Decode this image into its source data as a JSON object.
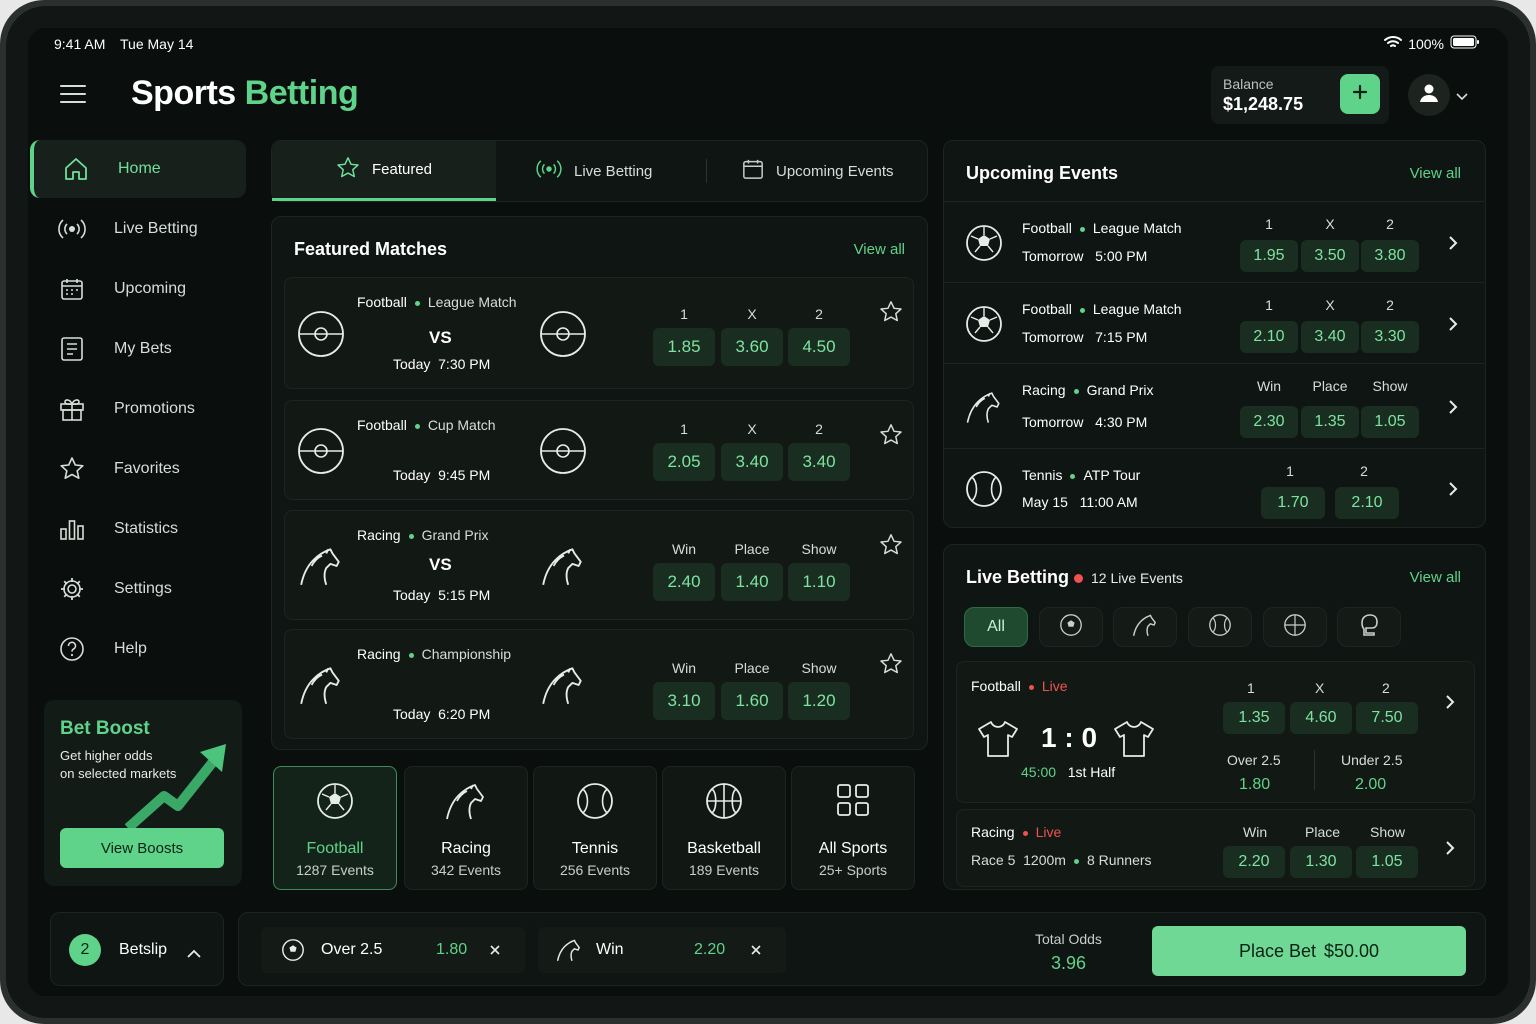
{
  "status": {
    "time": "9:41 AM",
    "date": "Tue May 14",
    "battery": "100%"
  },
  "header": {
    "title_a": "Sports",
    "title_b": "Betting",
    "balance_label": "Balance",
    "balance": "$1,248.75"
  },
  "sidebar": {
    "items": [
      {
        "label": "Home",
        "icon": "home-icon"
      },
      {
        "label": "Live Betting",
        "icon": "live-icon"
      },
      {
        "label": "Upcoming",
        "icon": "calendar-icon"
      },
      {
        "label": "My Bets",
        "icon": "receipt-icon"
      },
      {
        "label": "Promotions",
        "icon": "gift-icon"
      },
      {
        "label": "Favorites",
        "icon": "star-icon"
      },
      {
        "label": "Statistics",
        "icon": "bar-chart-icon"
      },
      {
        "label": "Settings",
        "icon": "gear-icon"
      },
      {
        "label": "Help",
        "icon": "help-icon"
      }
    ],
    "boost": {
      "title": "Bet Boost",
      "line1": "Get higher odds",
      "line2": "on selected markets",
      "button": "View Boosts"
    }
  },
  "tabs": [
    {
      "label": "Featured"
    },
    {
      "label": "Live Betting"
    },
    {
      "label": "Upcoming Events"
    }
  ],
  "featured": {
    "title": "Featured Matches",
    "view_all": "View all",
    "matches": [
      {
        "sport": "Football",
        "type": "League Match",
        "vs": "VS",
        "day": "Today",
        "time": "7:30 PM",
        "h": [
          "1",
          "X",
          "2"
        ],
        "o": [
          "1.85",
          "3.60",
          "4.50"
        ]
      },
      {
        "sport": "Football",
        "type": "Cup Match",
        "vs": "",
        "day": "Today",
        "time": "9:45 PM",
        "h": [
          "1",
          "X",
          "2"
        ],
        "o": [
          "2.05",
          "3.40",
          "3.40"
        ]
      },
      {
        "sport": "Racing",
        "type": "Grand Prix",
        "vs": "VS",
        "day": "Today",
        "time": "5:15 PM",
        "h": [
          "Win",
          "Place",
          "Show"
        ],
        "o": [
          "2.40",
          "1.40",
          "1.10"
        ]
      },
      {
        "sport": "Racing",
        "type": "Championship",
        "vs": "",
        "day": "Today",
        "time": "6:20 PM",
        "h": [
          "Win",
          "Place",
          "Show"
        ],
        "o": [
          "3.10",
          "1.60",
          "1.20"
        ]
      }
    ]
  },
  "sports": [
    {
      "name": "Football",
      "count": "1287 Events"
    },
    {
      "name": "Racing",
      "count": "342 Events"
    },
    {
      "name": "Tennis",
      "count": "256 Events"
    },
    {
      "name": "Basketball",
      "count": "189 Events"
    },
    {
      "name": "All Sports",
      "count": "25+ Sports"
    }
  ],
  "upcoming": {
    "title": "Upcoming Events",
    "view_all": "View all",
    "events": [
      {
        "sport": "Football",
        "type": "League Match",
        "day": "Tomorrow",
        "time": "5:00 PM",
        "h": [
          "1",
          "X",
          "2"
        ],
        "o": [
          "1.95",
          "3.50",
          "3.80"
        ]
      },
      {
        "sport": "Football",
        "type": "League Match",
        "day": "Tomorrow",
        "time": "7:15 PM",
        "h": [
          "1",
          "X",
          "2"
        ],
        "o": [
          "2.10",
          "3.40",
          "3.30"
        ]
      },
      {
        "sport": "Racing",
        "type": "Grand Prix",
        "day": "Tomorrow",
        "time": "4:30 PM",
        "h": [
          "Win",
          "Place",
          "Show"
        ],
        "o": [
          "2.30",
          "1.35",
          "1.05"
        ]
      },
      {
        "sport": "Tennis",
        "type": "ATP Tour",
        "day": "May 15",
        "time": "11:00 AM",
        "h": [
          "1",
          "2"
        ],
        "o": [
          "1.70",
          "2.10"
        ]
      }
    ]
  },
  "live": {
    "title": "Live Betting",
    "count": "12 Live Events",
    "view_all": "View all",
    "filter_all": "All",
    "football": {
      "sport": "Football",
      "status": "Live",
      "score": "1 : 0",
      "clock": "45:00",
      "period": "1st Half",
      "h": [
        "1",
        "X",
        "2"
      ],
      "o": [
        "1.35",
        "4.60",
        "7.50"
      ],
      "over_label": "Over 2.5",
      "over": "1.80",
      "under_label": "Under 2.5",
      "under": "2.00"
    },
    "racing": {
      "sport": "Racing",
      "status": "Live",
      "race": "Race 5",
      "dist": "1200m",
      "runners": "8 Runners",
      "h": [
        "Win",
        "Place",
        "Show"
      ],
      "o": [
        "2.20",
        "1.30",
        "1.05"
      ]
    }
  },
  "betslip": {
    "count": "2",
    "label": "Betslip",
    "sel1": {
      "label": "Over 2.5",
      "odds": "1.80"
    },
    "sel2": {
      "label": "Win",
      "odds": "2.20"
    },
    "total_label": "Total Odds",
    "total": "3.96",
    "place_label": "Place Bet",
    "stake": "$50.00"
  }
}
